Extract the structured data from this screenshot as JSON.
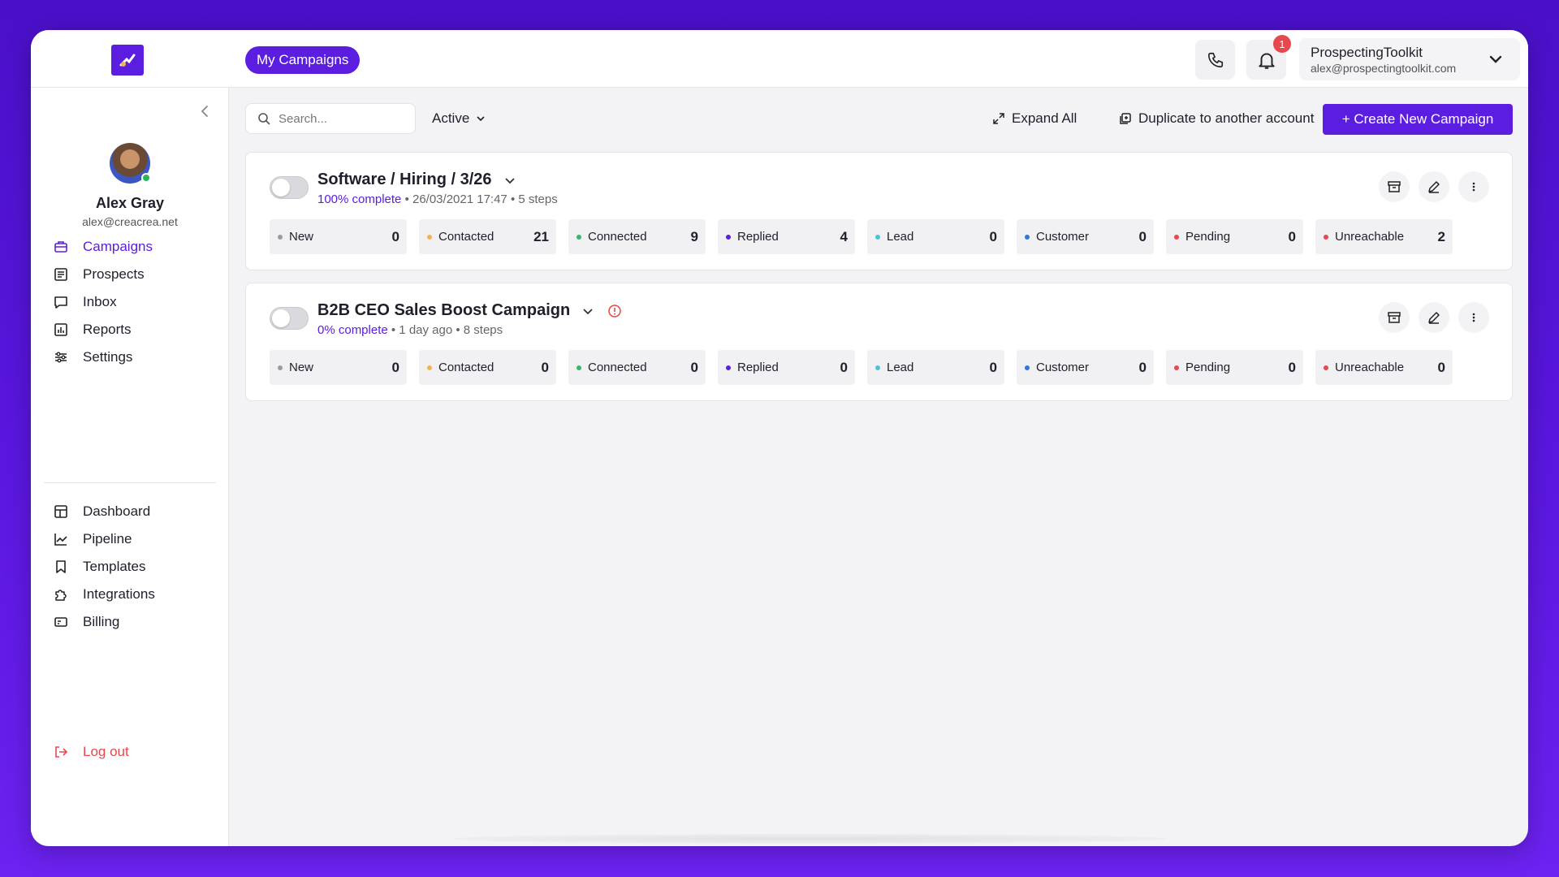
{
  "colors": {
    "accent": "#5b1de0",
    "danger": "#e5484d",
    "online": "#2fb45a"
  },
  "topbar": {
    "tab_label": "My Campaigns",
    "notifications_count": "1",
    "account_name": "ProspectingToolkit",
    "account_email": "alex@prospectingtoolkit.com"
  },
  "user": {
    "name": "Alex Gray",
    "email": "alex@creacrea.net"
  },
  "nav_primary": [
    {
      "label": "Campaigns",
      "icon": "briefcase-icon"
    },
    {
      "label": "Prospects",
      "icon": "list-icon"
    },
    {
      "label": "Inbox",
      "icon": "chat-icon"
    },
    {
      "label": "Reports",
      "icon": "report-icon"
    },
    {
      "label": "Settings",
      "icon": "sliders-icon"
    }
  ],
  "nav_secondary": [
    {
      "label": "Dashboard",
      "icon": "dashboard-icon"
    },
    {
      "label": "Pipeline",
      "icon": "chart-line-icon"
    },
    {
      "label": "Templates",
      "icon": "bookmark-icon"
    },
    {
      "label": "Integrations",
      "icon": "puzzle-icon"
    },
    {
      "label": "Billing",
      "icon": "card-icon"
    }
  ],
  "logout_label": "Log out",
  "toolbar": {
    "search_placeholder": "Search...",
    "filter_value": "Active",
    "expand_label": "Expand All",
    "duplicate_label": "Duplicate to another account",
    "create_label": "+ Create New Campaign"
  },
  "campaigns": [
    {
      "title": "Software / Hiring / 3/26",
      "progress": "100% complete",
      "meta": " • 26/03/2021 17:47 • 5 steps",
      "stats": [
        {
          "label": "New",
          "value": "0"
        },
        {
          "label": "Contacted",
          "value": "21"
        },
        {
          "label": "Connected",
          "value": "9"
        },
        {
          "label": "Replied",
          "value": "4"
        },
        {
          "label": "Lead",
          "value": "0"
        },
        {
          "label": "Customer",
          "value": "0"
        },
        {
          "label": "Pending",
          "value": "0"
        },
        {
          "label": "Unreachable",
          "value": "2"
        }
      ]
    },
    {
      "title": "B2B CEO Sales Boost Campaign",
      "progress": "0% complete",
      "meta": " • 1 day ago • 8 steps",
      "stats": [
        {
          "label": "New",
          "value": "0"
        },
        {
          "label": "Contacted",
          "value": "0"
        },
        {
          "label": "Connected",
          "value": "0"
        },
        {
          "label": "Replied",
          "value": "0"
        },
        {
          "label": "Lead",
          "value": "0"
        },
        {
          "label": "Customer",
          "value": "0"
        },
        {
          "label": "Pending",
          "value": "0"
        },
        {
          "label": "Unreachable",
          "value": "0"
        }
      ]
    }
  ],
  "stat_colors": {
    "New": "#9a9aa6",
    "Contacted": "#f0b64a",
    "Connected": "#39b56a",
    "Replied": "#5b1de0",
    "Lead": "#4cc3d9",
    "Customer": "#2b78e4",
    "Pending": "#e5484d",
    "Unreachable": "#e5484d"
  }
}
